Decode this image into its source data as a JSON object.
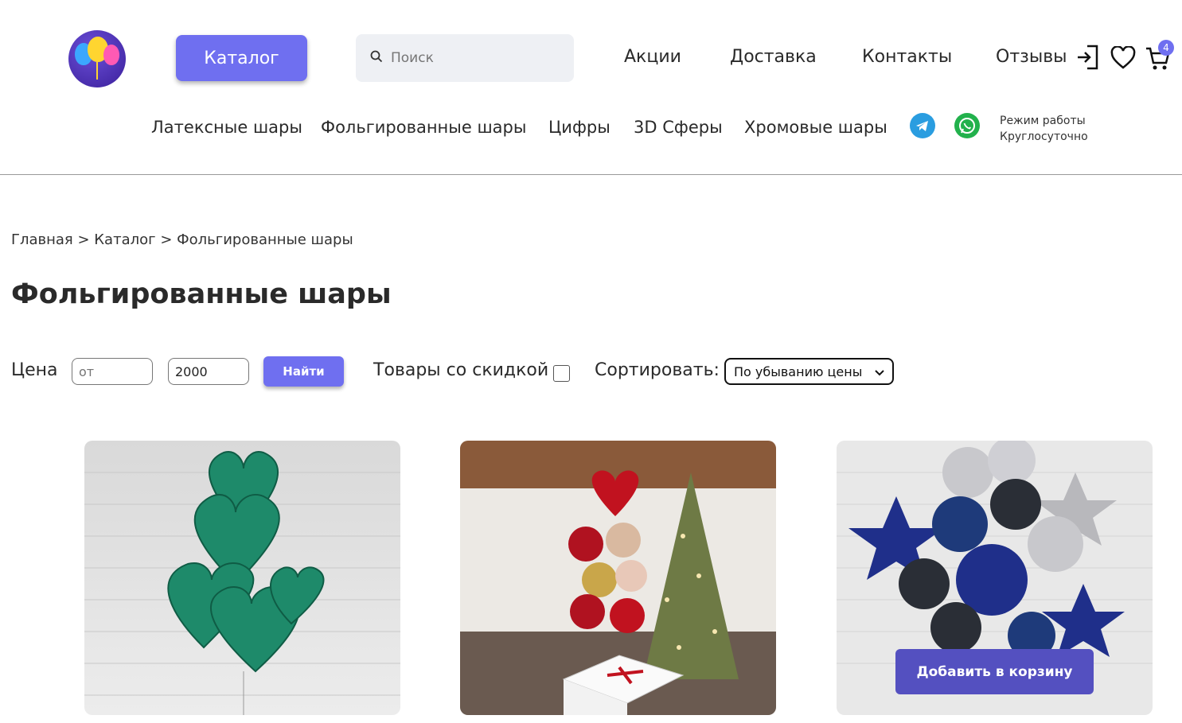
{
  "header": {
    "catalog_button": "Каталог",
    "search_placeholder": "Поиск",
    "nav": [
      "Акции",
      "Доставка",
      "Контакты",
      "Отзывы"
    ],
    "cart_count": "4"
  },
  "category_nav": [
    "Латексные шары",
    "Фольгированные шары",
    "Цифры",
    "3D Сферы",
    "Хромовые шары"
  ],
  "hours": {
    "line1": "Режим работы",
    "line2": "Круглосуточно"
  },
  "breadcrumb": {
    "home": "Главная",
    "sep": " > ",
    "catalog": "Каталог",
    "current": "Фольгированные шары"
  },
  "page_title": "Фольгированные шары",
  "filters": {
    "price_label": "Цена",
    "from_placeholder": "от",
    "to_value": "2000",
    "find_button": "Найти",
    "discount_label": "Товары со скидкой",
    "discount_checked": false,
    "sort_label": "Сортировать:",
    "sort_value": "По убыванию цены"
  },
  "products": {
    "add_to_cart": "Добавить в корзину"
  },
  "colors": {
    "accent": "#6f6ff0",
    "add_button": "#5450c0",
    "telegram": "#2a9de0",
    "whatsapp": "#22b14c"
  }
}
